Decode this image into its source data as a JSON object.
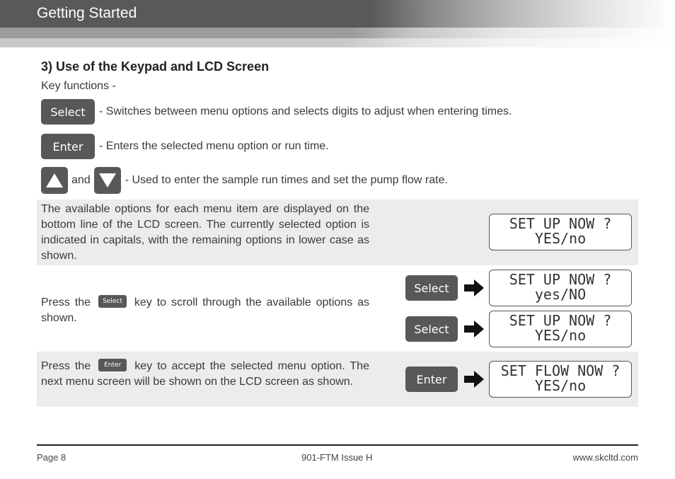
{
  "header": {
    "title": "Getting Started"
  },
  "section": {
    "title": "3) Use of the Keypad and LCD Screen",
    "key_functions_label": "Key functions -",
    "keys": [
      {
        "label": "Select",
        "description": "- Switches between menu options and selects digits to adjust when entering times."
      },
      {
        "label": "Enter",
        "description": "- Enters the selected menu option or run time."
      },
      {
        "up_icon": "up-arrow-key",
        "joiner": "and",
        "down_icon": "down-arrow-key",
        "description": "- Used to enter the sample run times and set the pump flow rate."
      }
    ]
  },
  "panels": [
    {
      "text": "The available options for each menu item are displayed on the bottom line of the LCD screen. The currently selected option is indicated in capitals, with the remaining options in lower case as shown.",
      "lcd": {
        "line1": "SET UP NOW ?",
        "line2": "YES/no"
      }
    },
    {
      "text_before": "Press the",
      "inline_key": "Select",
      "text_after": "key to scroll through the available options as shown.",
      "steps": [
        {
          "key": "Select",
          "lcd": {
            "line1": "SET UP NOW ?",
            "line2": "yes/NO"
          }
        },
        {
          "key": "Select",
          "lcd": {
            "line1": "SET UP NOW ?",
            "line2": "YES/no"
          }
        }
      ]
    },
    {
      "text_before": "Press the",
      "inline_key": "Enter",
      "text_after": "key to accept the selected menu option. The next menu screen will be shown on the LCD screen as shown.",
      "steps": [
        {
          "key": "Enter",
          "lcd": {
            "line1": "SET FLOW NOW ?",
            "line2": "YES/no"
          }
        }
      ]
    }
  ],
  "footer": {
    "page": "Page 8",
    "doc": "901-FTM Issue H",
    "url": "www.skcltd.com"
  },
  "colors": {
    "key_bg": "#58585a",
    "panel_bg": "#ececec",
    "header_dark": "#59595b"
  }
}
